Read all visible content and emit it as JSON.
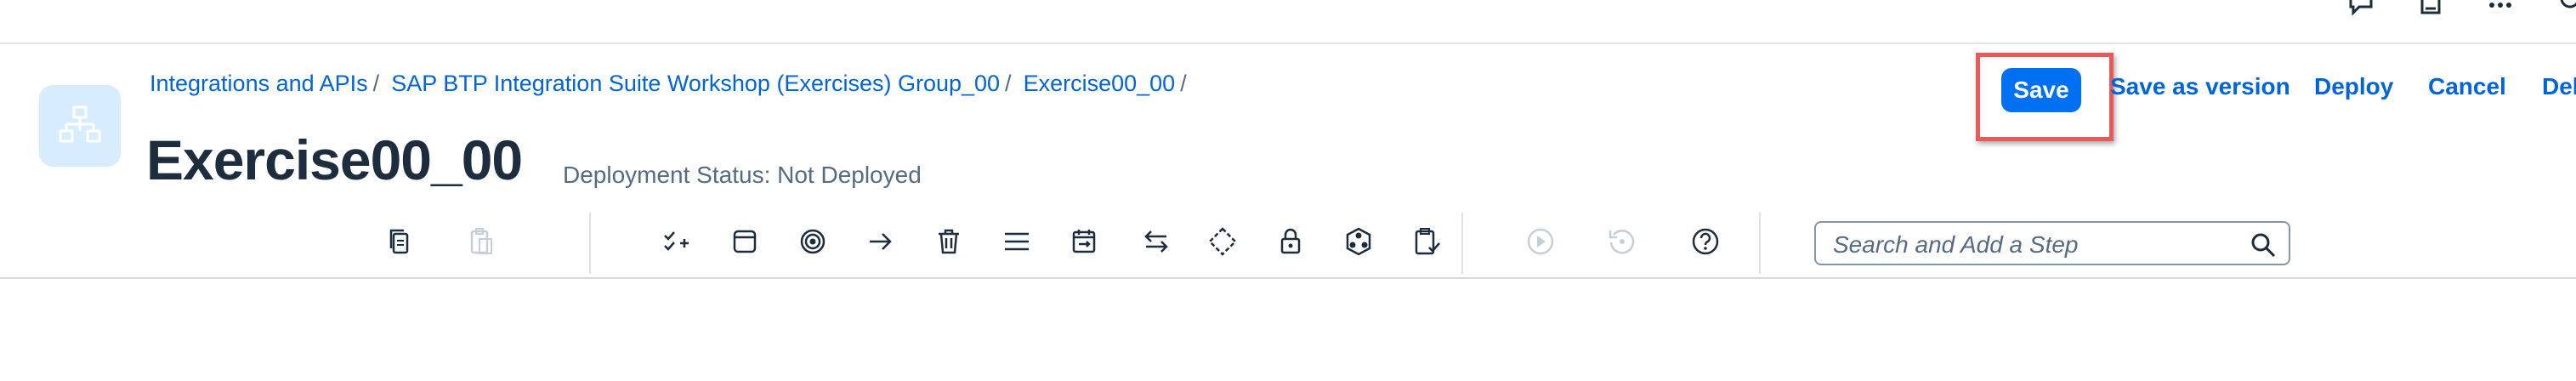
{
  "shell": {
    "icons": [
      "feedback-icon",
      "notes-icon",
      "app-grid-icon",
      "user-icon"
    ]
  },
  "header": {
    "breadcrumb": [
      {
        "label": "Integrations and APIs"
      },
      {
        "label": "SAP BTP Integration Suite Workshop (Exercises) Group_00"
      },
      {
        "label": "Exercise00_00"
      }
    ],
    "separator": "/",
    "title": "Exercise00_00",
    "deployment_status": "Deployment Status: Not Deployed"
  },
  "actions": {
    "save_label": "Save",
    "save_as_version_label": "Save as version",
    "deploy_label": "Deploy",
    "cancel_label": "Cancel",
    "delete_label": "Del"
  },
  "toolbar": {
    "search_placeholder": "Search and Add a Step",
    "icons": [
      "copy-icon",
      "paste-icon",
      "add-task-icon",
      "message-icon",
      "target-icon",
      "arrow-right-icon",
      "delete-icon",
      "menu-icon",
      "schedule-icon",
      "swap-icon",
      "gateway-icon",
      "lock-icon",
      "process-icon",
      "validate-icon",
      "play-icon",
      "reset-icon",
      "help-icon"
    ]
  },
  "colors": {
    "accent": "#0070f2",
    "link": "#0064d9",
    "highlight": "#e8595a",
    "title": "#1d2d3e"
  }
}
